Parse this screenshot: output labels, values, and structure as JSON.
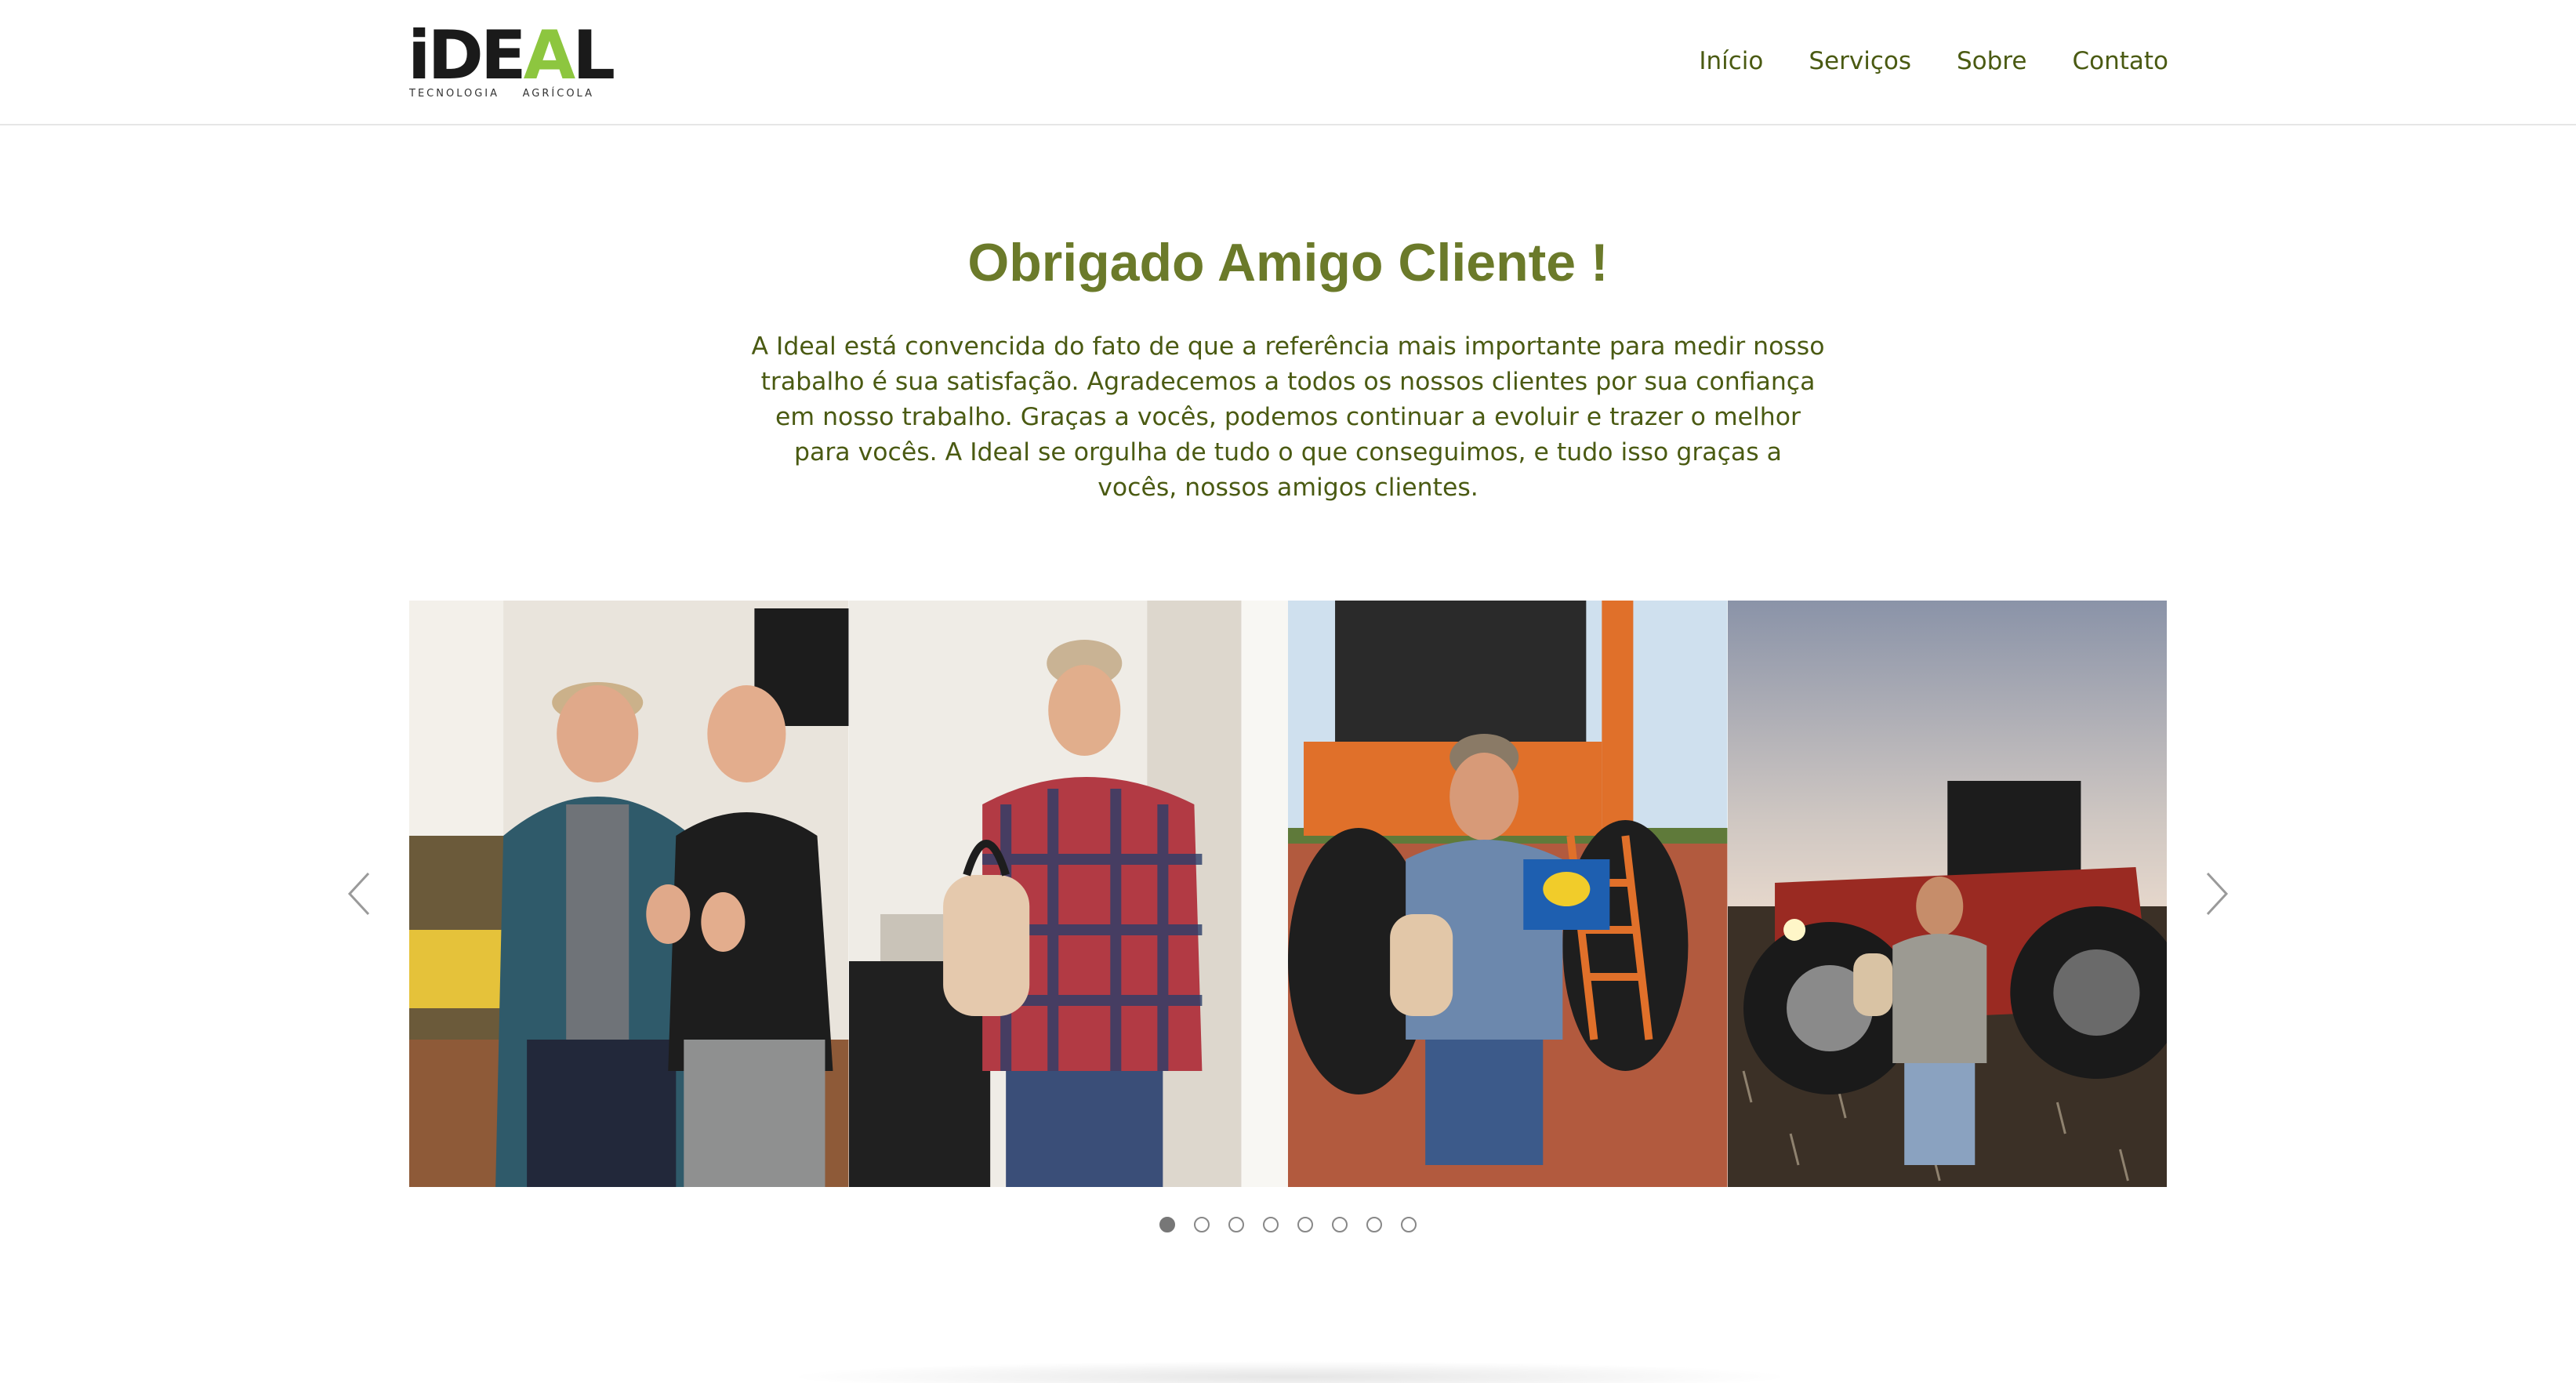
{
  "brand": {
    "logo_word_left": "iDE",
    "logo_word_accent": "A",
    "logo_word_right": "L",
    "logo_sub_left": "TECNOLOGIA",
    "logo_sub_right": "AGRÍCOLA"
  },
  "nav": {
    "items": [
      {
        "label": "Início"
      },
      {
        "label": "Serviços"
      },
      {
        "label": "Sobre"
      },
      {
        "label": "Contato"
      }
    ]
  },
  "main": {
    "title": "Obrigado Amigo Cliente !",
    "intro": "A Ideal está convencida do fato de que a referência mais importante para medir nosso trabalho é sua satisfação. Agradecemos a todos os nossos clientes por sua confiança em nosso trabalho. Graças a vocês, podemos continuar a evoluir e trazer o melhor para vocês. A Ideal se orgulha de tudo o que conseguimos, e tudo isso graças a vocês, nossos amigos clientes."
  },
  "carousel": {
    "slides": [
      {
        "scene": "two-men-thumbs-up"
      },
      {
        "scene": "man-plaid-shirt-bag"
      },
      {
        "scene": "man-orange-sprayer"
      },
      {
        "scene": "man-red-tractor-dusk"
      }
    ],
    "icons": {
      "prev": "chevron-left-icon",
      "next": "chevron-right-icon"
    },
    "pagination_count": 8,
    "active_index": 0
  },
  "colors": {
    "brand_green": "#6b7a2a",
    "text_olive": "#4a5a12",
    "logo_accent": "#8dc63f"
  }
}
